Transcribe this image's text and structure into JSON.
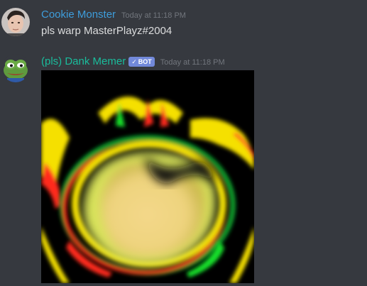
{
  "messages": [
    {
      "author": "Cookie Monster",
      "author_color": "#3e9ddb",
      "timestamp": "Today at 11:18 PM",
      "text": "pls warp MasterPlayz#2004"
    },
    {
      "author": "(pls) Dank Memer",
      "author_color": "#1abc9c",
      "bot_tag": "BOT",
      "bot_check": "✓",
      "timestamp": "Today at 11:18 PM",
      "attachment": "warped-image"
    }
  ],
  "colors": {
    "background": "#36393f",
    "text": "#dcddde",
    "timestamp": "#72767d",
    "bot_tag": "#7289da"
  }
}
